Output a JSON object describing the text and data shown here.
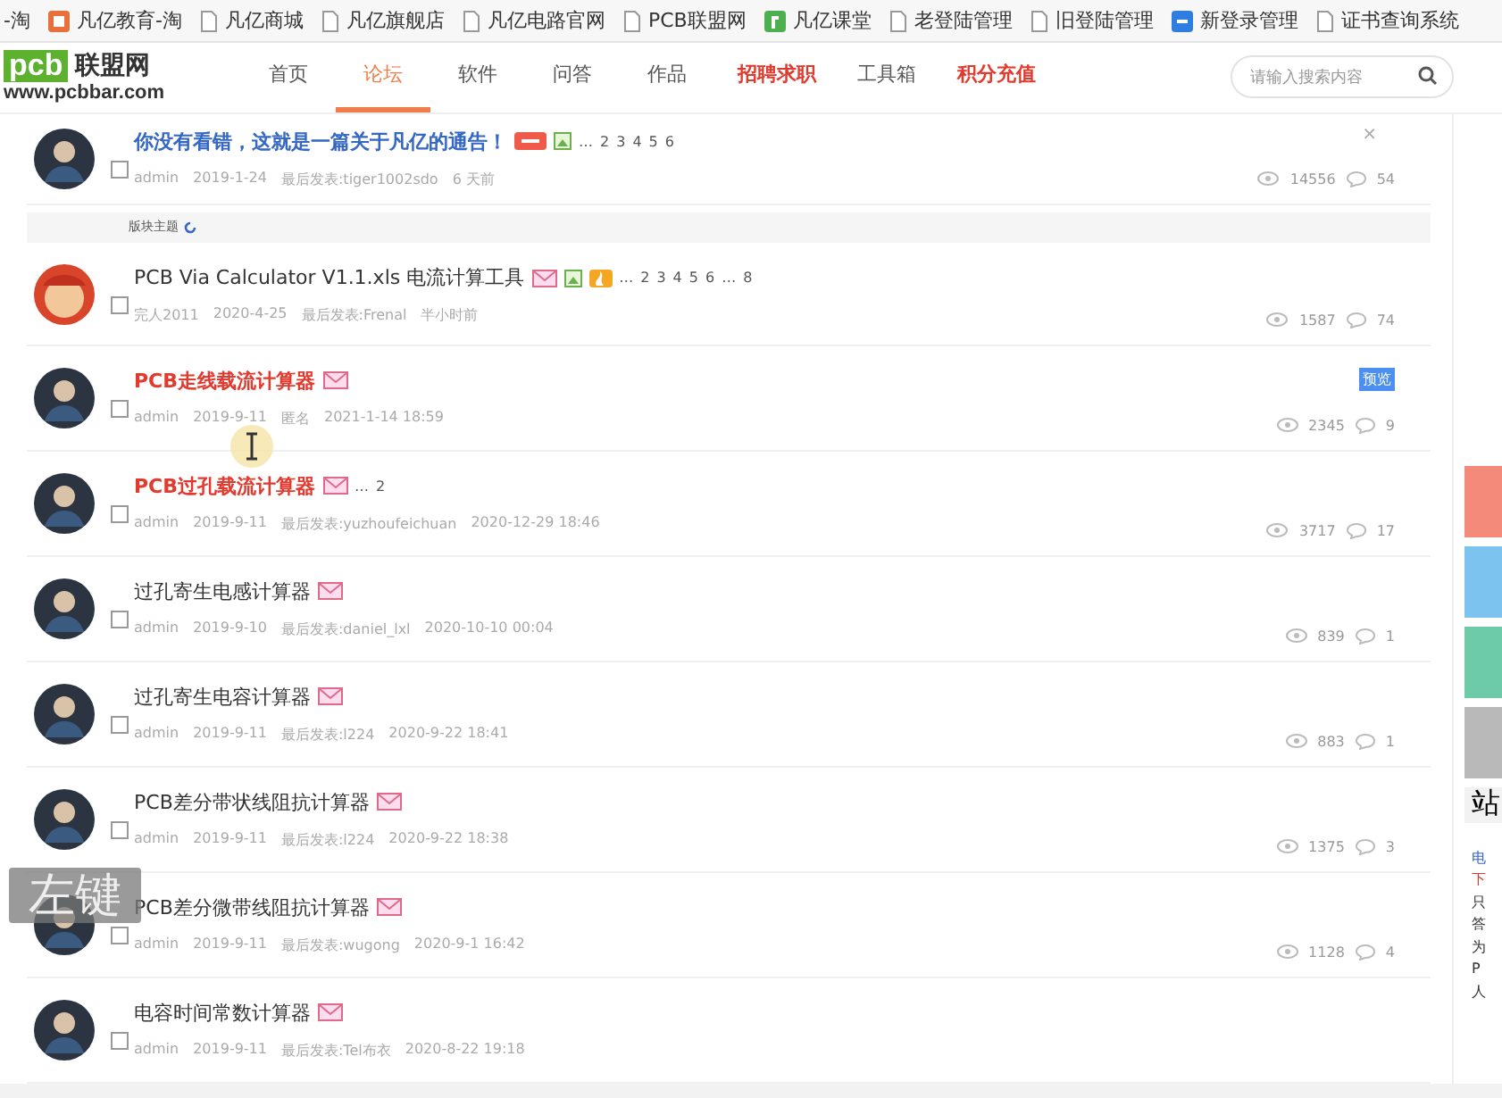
{
  "bookmarks": [
    {
      "label": "-淘",
      "kind": "none"
    },
    {
      "label": "凡亿教育-淘",
      "kind": "orange"
    },
    {
      "label": "凡亿商城",
      "kind": "page"
    },
    {
      "label": "凡亿旗舰店",
      "kind": "page"
    },
    {
      "label": "凡亿电路官网",
      "kind": "page"
    },
    {
      "label": "PCB联盟网",
      "kind": "page"
    },
    {
      "label": "凡亿课堂",
      "kind": "green"
    },
    {
      "label": "老登陆管理",
      "kind": "page"
    },
    {
      "label": "旧登陆管理",
      "kind": "page"
    },
    {
      "label": "新登录管理",
      "kind": "blue"
    },
    {
      "label": "证书查询系统",
      "kind": "page"
    }
  ],
  "logo": {
    "mark": "pcb",
    "name": "联盟网",
    "url": "www.pcbbar.com"
  },
  "nav": [
    {
      "label": "首页",
      "kind": "normal",
      "selected": false
    },
    {
      "label": "论坛",
      "kind": "normal",
      "selected": true
    },
    {
      "label": "软件",
      "kind": "normal",
      "selected": false
    },
    {
      "label": "问答",
      "kind": "normal",
      "selected": false
    },
    {
      "label": "作品",
      "kind": "normal",
      "selected": false
    },
    {
      "label": "招聘求职",
      "kind": "promo",
      "selected": false
    },
    {
      "label": "工具箱",
      "kind": "normal",
      "selected": false
    },
    {
      "label": "积分充值",
      "kind": "promo",
      "selected": false
    }
  ],
  "search": {
    "placeholder": "请输入搜索内容"
  },
  "sticky": [
    {
      "kind": "notice",
      "title": "你没有看错，这就是一篇关于凡亿的通告！",
      "badges": [
        {
          "kind": "pinned"
        },
        {
          "kind": "image"
        }
      ],
      "pages": [
        "…",
        "2",
        "3",
        "4",
        "5",
        "6"
      ],
      "meta": [
        "admin",
        "2019-1-24",
        "最后发表:tiger1002sdo",
        "6 天前"
      ],
      "views": "14556",
      "replies": "54",
      "close": "×",
      "avatar": {
        "kind": "figure"
      },
      "checked": false
    }
  ],
  "section": {
    "label": "版块主题"
  },
  "threads": [
    {
      "kind": "normal",
      "title": "PCB Via Calculator V1.1.xls 电流计算工具",
      "badges": [
        {
          "kind": "mail"
        },
        {
          "kind": "image"
        },
        {
          "kind": "hot"
        }
      ],
      "pages": [
        "…",
        "2",
        "3",
        "4",
        "5",
        "6",
        "…",
        "8"
      ],
      "meta": [
        "完人2011",
        "2020-4-25",
        "最后发表:Frenal",
        "半小时前"
      ],
      "views": "1587",
      "replies": "74",
      "avatar": {
        "kind": "cartoon"
      },
      "checked": false
    },
    {
      "kind": "highlight",
      "title": "PCB走线载流计算器",
      "badges": [
        {
          "kind": "mail"
        }
      ],
      "tag": "预览",
      "meta": [
        "admin",
        "2019-9-11",
        "匿名",
        "2021-1-14 18:59"
      ],
      "views": "2345",
      "replies": "9",
      "avatar": {
        "kind": "figure"
      },
      "checked": false
    },
    {
      "kind": "highlight",
      "title": "PCB过孔载流计算器",
      "badges": [
        {
          "kind": "mail"
        }
      ],
      "pages": [
        "…",
        "2"
      ],
      "meta": [
        "admin",
        "2019-9-11",
        "最后发表:yuzhoufeichuan",
        "2020-12-29 18:46"
      ],
      "views": "3717",
      "replies": "17",
      "avatar": {
        "kind": "figure"
      },
      "checked": false
    },
    {
      "kind": "normal",
      "title": "过孔寄生电感计算器",
      "badges": [
        {
          "kind": "mail"
        }
      ],
      "meta": [
        "admin",
        "2019-9-10",
        "最后发表:daniel_lxl",
        "2020-10-10 00:04"
      ],
      "views": "839",
      "replies": "1",
      "avatar": {
        "kind": "figure"
      },
      "checked": false
    },
    {
      "kind": "normal",
      "title": "过孔寄生电容计算器",
      "badges": [
        {
          "kind": "mail"
        }
      ],
      "meta": [
        "admin",
        "2019-9-11",
        "最后发表:l224",
        "2020-9-22 18:41"
      ],
      "views": "883",
      "replies": "1",
      "avatar": {
        "kind": "figure"
      },
      "checked": false
    },
    {
      "kind": "normal",
      "title": "PCB差分带状线阻抗计算器",
      "badges": [
        {
          "kind": "mail"
        }
      ],
      "meta": [
        "admin",
        "2019-9-11",
        "最后发表:l224",
        "2020-9-22 18:38"
      ],
      "views": "1375",
      "replies": "3",
      "avatar": {
        "kind": "figure"
      },
      "checked": false
    },
    {
      "kind": "normal",
      "title": "PCB差分微带线阻抗计算器",
      "badges": [
        {
          "kind": "mail"
        }
      ],
      "meta": [
        "admin",
        "2019-9-11",
        "最后发表:wugong",
        "2020-9-1 16:42"
      ],
      "views": "1128",
      "replies": "4",
      "avatar": {
        "kind": "figure"
      },
      "checked": false
    },
    {
      "kind": "normal",
      "title": "电容时间常数计算器",
      "badges": [
        {
          "kind": "mail"
        }
      ],
      "meta": [
        "admin",
        "2019-9-11",
        "最后发表:Tel布衣",
        "2020-8-22 19:18"
      ],
      "avatar": {
        "kind": "figure"
      },
      "checked": false
    }
  ],
  "side_buttons": [
    {
      "color": "#f48b7a"
    },
    {
      "color": "#7cc4ef"
    },
    {
      "color": "#6dcba9"
    },
    {
      "color": "#b9b9b9"
    }
  ],
  "side_heading": "站",
  "side_lines": [
    {
      "text": "电",
      "kind": "link"
    },
    {
      "text": "下",
      "kind": "hot"
    },
    {
      "text": "只",
      "kind": "plain"
    },
    {
      "text": "答",
      "kind": "plain"
    },
    {
      "text": "为",
      "kind": "plain"
    },
    {
      "text": "P",
      "kind": "plain"
    },
    {
      "text": "人",
      "kind": "plain"
    }
  ],
  "key_overlay": "左键"
}
